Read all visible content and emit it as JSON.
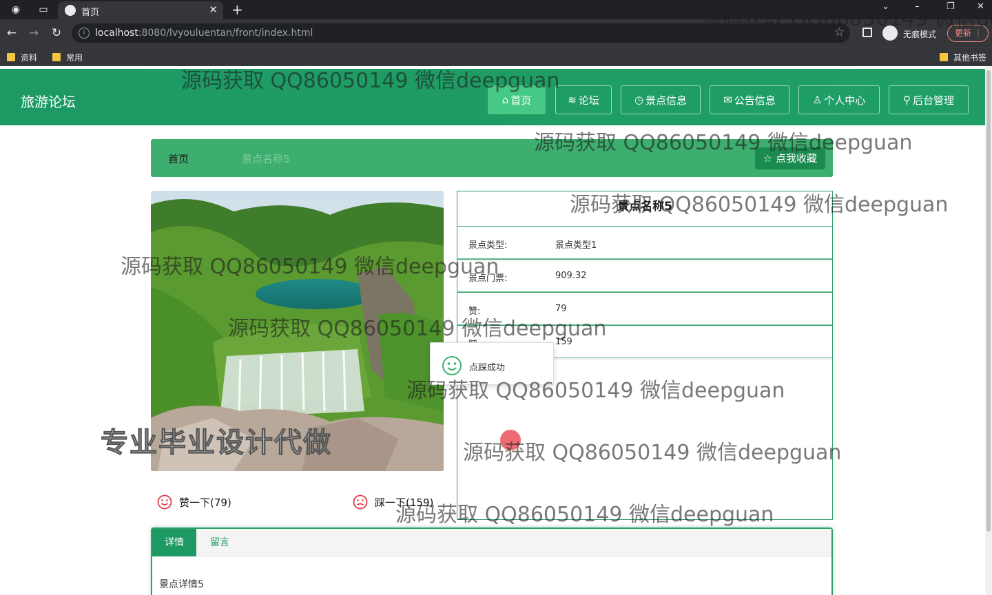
{
  "browser": {
    "tab_title": "首页",
    "url_host": "localhost",
    "url_rest": ":8080/lvyouluentan/front/index.html",
    "incognito_label": "无痕模式",
    "update_label": "更新",
    "bookmarks": [
      "资料",
      "常用"
    ],
    "other_bookmarks": "其他书签"
  },
  "site": {
    "title": "旅游论坛",
    "nav": [
      {
        "icon": "⌂",
        "label": "首页"
      },
      {
        "icon": "≋",
        "label": "论坛"
      },
      {
        "icon": "◷",
        "label": "景点信息"
      },
      {
        "icon": "✉",
        "label": "公告信息"
      },
      {
        "icon": "♙",
        "label": "个人中心"
      },
      {
        "icon": "⚲",
        "label": "后台管理"
      }
    ]
  },
  "breadcrumb": {
    "home": "首页",
    "current": "景点名称5",
    "favorite_icon": "☆",
    "favorite_label": "点我收藏"
  },
  "detail": {
    "name": "景点名称5",
    "rows": [
      {
        "label": "景点类型:",
        "value": "景点类型1"
      },
      {
        "label": "景点门票:",
        "value": "909.32"
      },
      {
        "label": "赞:",
        "value": "79"
      },
      {
        "label": "踩:",
        "value": "159"
      }
    ]
  },
  "toast": {
    "text": "点踩成功"
  },
  "votes": {
    "like_label": "赞一下(79)",
    "dislike_label": "踩一下(159)"
  },
  "tabs": {
    "items": [
      "详情",
      "留言"
    ],
    "content": "景点详情5"
  },
  "overlay": {
    "ad_text": "专业毕业设计代做",
    "watermark": "源码获取 QQ86050149 微信deepguan"
  },
  "colors": {
    "primary": "#1d9a63",
    "nav_active": "#46c985",
    "breadcrumb_bg": "#3dae6e"
  }
}
